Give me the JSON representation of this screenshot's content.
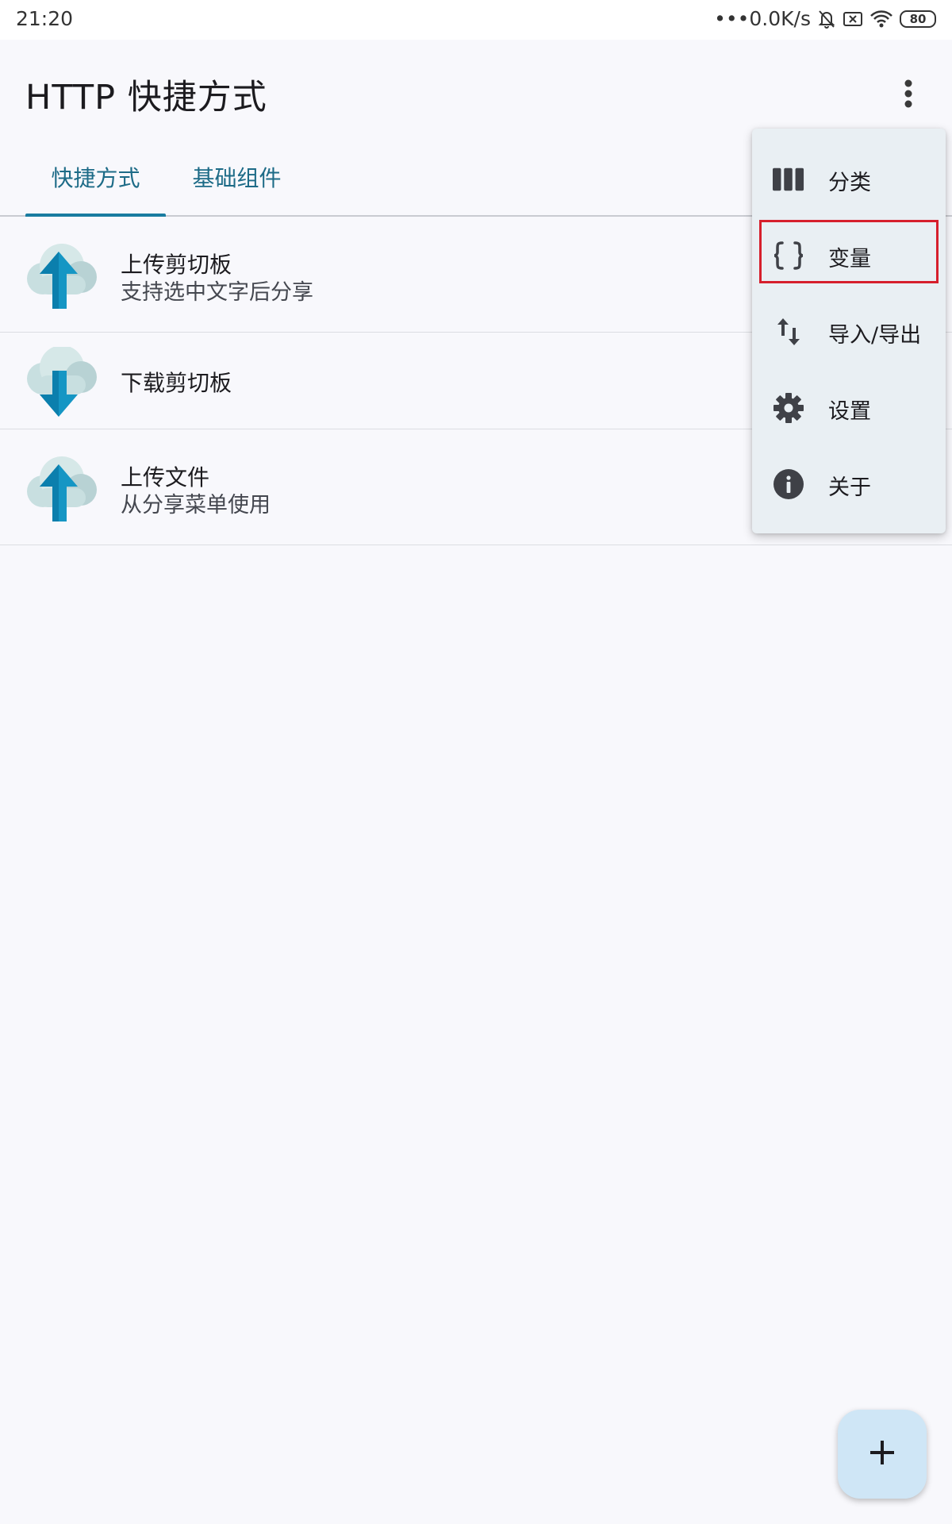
{
  "status_bar": {
    "time": "21:20",
    "network_speed": "•••0.0K/s",
    "battery": "80",
    "icons": [
      "mute-bell-icon",
      "sim-blocked-icon",
      "wifi-icon",
      "battery-icon"
    ]
  },
  "app_bar": {
    "title": "HTTP 快捷方式",
    "overflow_icon": "more-vert-icon"
  },
  "tabs": [
    {
      "label": "快捷方式",
      "selected": true
    },
    {
      "label": "基础组件",
      "selected": false
    }
  ],
  "shortcuts": [
    {
      "title": "上传剪切板",
      "subtitle": "支持选中文字后分享",
      "icon": "cloud-upload-icon"
    },
    {
      "title": "下载剪切板",
      "subtitle": "",
      "icon": "cloud-download-icon"
    },
    {
      "title": "上传文件",
      "subtitle": "从分享菜单使用",
      "icon": "cloud-upload-icon"
    }
  ],
  "menu": {
    "items": [
      {
        "label": "分类",
        "icon": "categories-icon"
      },
      {
        "label": "变量",
        "icon": "curly-braces-icon",
        "highlighted": true
      },
      {
        "label": "导入/导出",
        "icon": "import-export-icon"
      },
      {
        "label": "设置",
        "icon": "gear-icon"
      },
      {
        "label": "关于",
        "icon": "info-icon"
      }
    ]
  },
  "fab": {
    "icon": "plus-icon"
  },
  "colors": {
    "accent": "#1a7ca0",
    "tab_text": "#1d6b87",
    "menu_background": "#e9eff3",
    "highlight_border": "#d61f2c",
    "fab_background": "#cfe6f6"
  }
}
